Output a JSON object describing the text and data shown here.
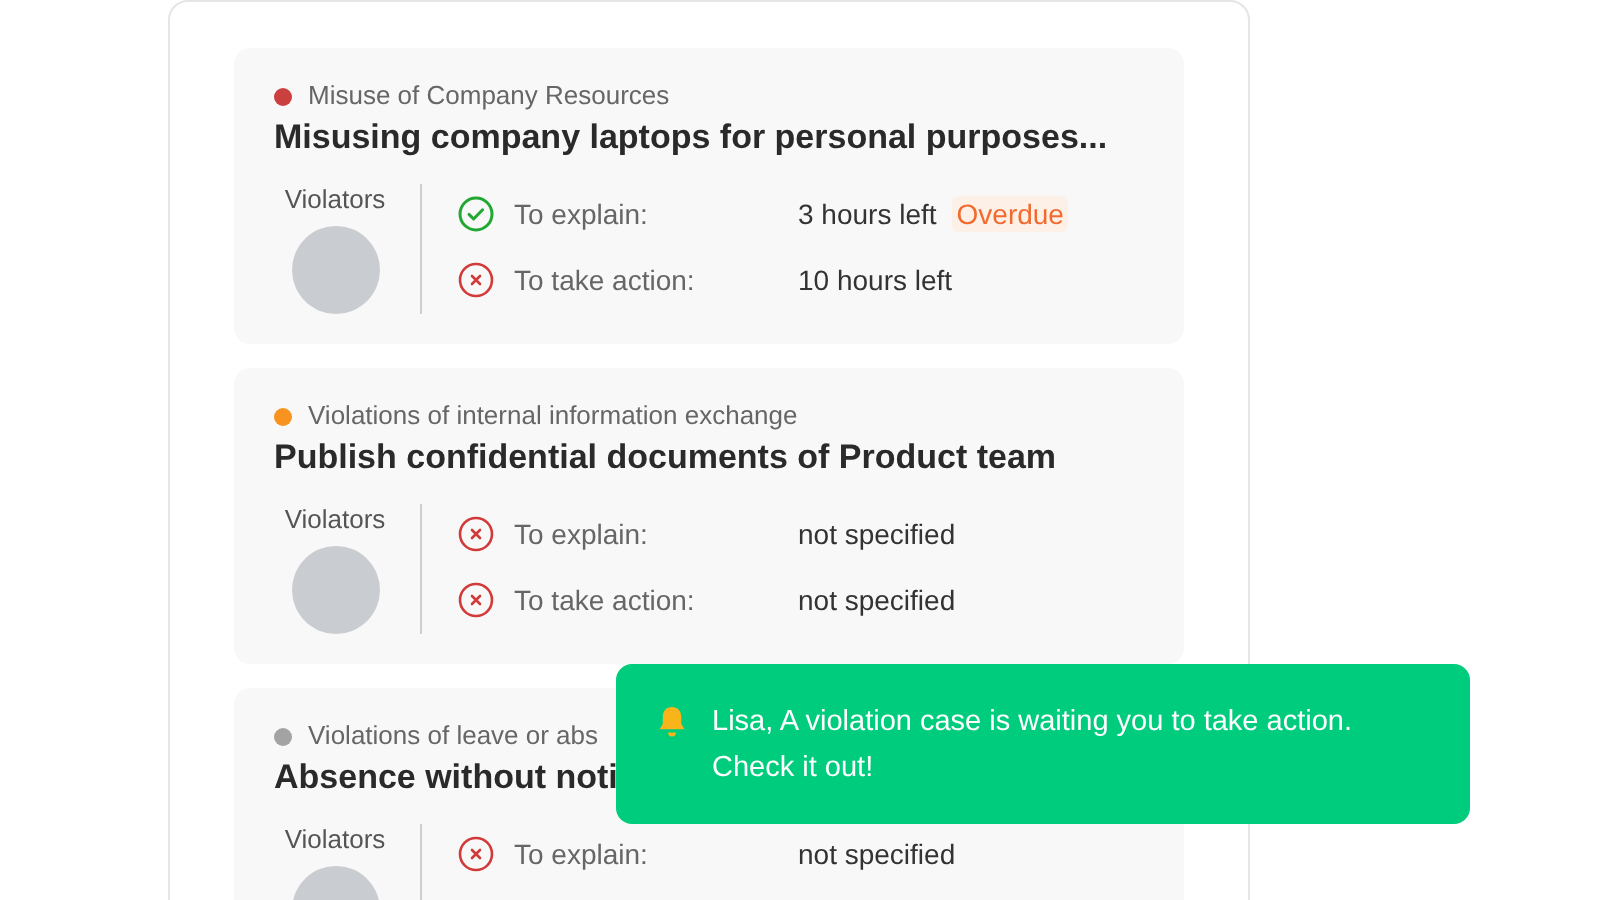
{
  "cases": [
    {
      "category": "Misuse of Company Resources",
      "color": "#c9403f",
      "title": "Misusing company laptops for personal purposes...",
      "violators_label": "Violators",
      "deadlines": [
        {
          "label": "To explain:",
          "value": "3 hours left",
          "done": true,
          "badge": "Overdue"
        },
        {
          "label": "To take action:",
          "value": "10 hours left",
          "done": false
        }
      ]
    },
    {
      "category": "Violations of internal information exchange",
      "color": "#f7931e",
      "title": "Publish confidential documents of Product team",
      "violators_label": "Violators",
      "deadlines": [
        {
          "label": "To explain:",
          "value": "not specified",
          "done": false
        },
        {
          "label": "To take action:",
          "value": "not specified",
          "done": false
        }
      ]
    },
    {
      "category": "Violations of leave or abs",
      "color": "#a3a3a3",
      "title": "Absence without noti",
      "violators_label": "Violators",
      "deadlines": [
        {
          "label": "To explain:",
          "value": "not specified",
          "done": false
        }
      ]
    }
  ],
  "toast": {
    "message": "Lisa, A violation case is waiting you to take action. Check it out!"
  }
}
